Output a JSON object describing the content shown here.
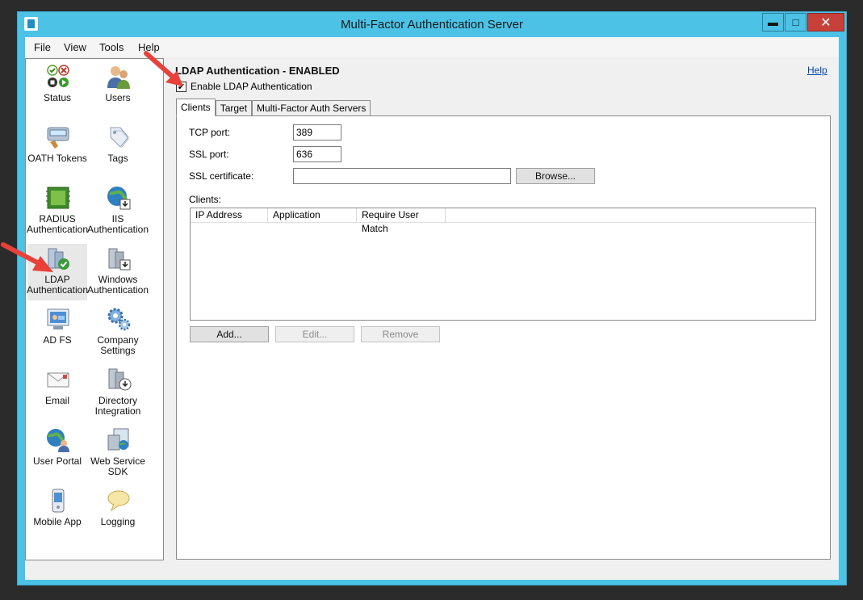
{
  "window": {
    "title": "Multi-Factor Authentication Server",
    "controls": {
      "minimize": "▬",
      "maximize": "□",
      "close": "✕"
    }
  },
  "menu": [
    "File",
    "View",
    "Tools",
    "Help"
  ],
  "nav": [
    {
      "label": "Status",
      "icon": "status-icon"
    },
    {
      "label": "Users",
      "icon": "users-icon"
    },
    {
      "label": "OATH Tokens",
      "icon": "oath-tokens-icon"
    },
    {
      "label": "Tags",
      "icon": "tags-icon"
    },
    {
      "label": "RADIUS Authentication",
      "icon": "radius-icon"
    },
    {
      "label": "IIS Authentication",
      "icon": "iis-icon"
    },
    {
      "label": "LDAP Authentication",
      "icon": "ldap-icon",
      "selected": true
    },
    {
      "label": "Windows Authentication",
      "icon": "windows-auth-icon"
    },
    {
      "label": "AD FS",
      "icon": "adfs-icon"
    },
    {
      "label": "Company Settings",
      "icon": "company-settings-icon"
    },
    {
      "label": "Email",
      "icon": "email-icon"
    },
    {
      "label": "Directory Integration",
      "icon": "directory-integration-icon"
    },
    {
      "label": "User Portal",
      "icon": "user-portal-icon"
    },
    {
      "label": "Web Service SDK",
      "icon": "web-service-sdk-icon"
    },
    {
      "label": "Mobile App",
      "icon": "mobile-app-icon"
    },
    {
      "label": "Logging",
      "icon": "logging-icon"
    }
  ],
  "main": {
    "title": "LDAP Authentication - ENABLED",
    "help": "Help",
    "enable_label": "Enable LDAP Authentication",
    "enable_checked": true,
    "tabs": [
      "Clients",
      "Target",
      "Multi-Factor Auth Servers"
    ],
    "active_tab": "Clients",
    "form": {
      "tcp_label": "TCP port:",
      "tcp_value": "389",
      "ssl_label": "SSL port:",
      "ssl_value": "636",
      "cert_label": "SSL certificate:",
      "cert_value": "",
      "browse_label": "Browse...",
      "clients_label": "Clients:",
      "columns": [
        "IP Address",
        "Application",
        "Require User Match"
      ],
      "add_label": "Add...",
      "edit_label": "Edit...",
      "remove_label": "Remove"
    }
  },
  "colors": {
    "window_frame": "#4cc2e6",
    "close_button": "#c7413a",
    "annotation_arrow": "#e8413a",
    "link": "#0645ad"
  }
}
